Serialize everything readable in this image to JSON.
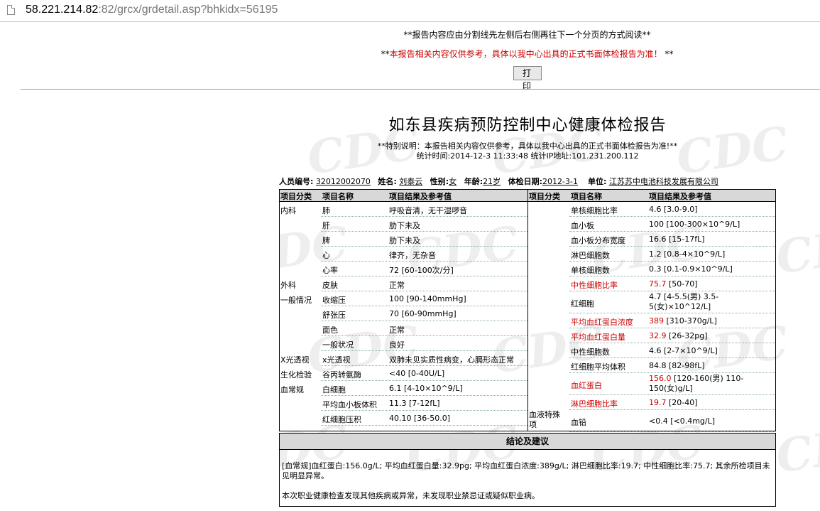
{
  "browser": {
    "url_host": "58.221.214.82",
    "url_rest": ":82/grcx/grdetail.asp?bhkidx=56195"
  },
  "notice": {
    "line1": "**报告内容应由分割线先左侧后右侧再往下一个分页的方式阅读**",
    "line2_prefix": "**",
    "line2_red": "本报告相关内容仅供参考，具体以我中心出具的正式书面体检报告为准！",
    "line2_suffix": " **"
  },
  "print_button": "打印",
  "watermark_text": "CDC",
  "report": {
    "title": "如东县疾病预防控制中心健康体检报告",
    "special_note": "**特别说明：本报告相关内容仅供参考，具体以我中心出具的正式书面体检报告为准!**",
    "stats_line": "统计时间:2014-12-3 11:33:48  统计IP地址:101.231.200.112"
  },
  "person": {
    "id_label": "人员编号:",
    "id_value": "32012002070",
    "name_label": "姓名:",
    "name_value": "刘泰云",
    "sex_label": "性别:",
    "sex_value": "女",
    "age_label": "年龄:",
    "age_value": "21岁",
    "date_label": "体检日期:",
    "date_value": "2012-3-1",
    "unit_label": "单位:",
    "unit_value": "江苏苏中电池科技发展有限公司"
  },
  "table_headers": {
    "category": "项目分类",
    "item": "项目名称",
    "result": "项目结果及参考值"
  },
  "left_rows": [
    {
      "cat": "内科",
      "item": "肺",
      "result": "呼吸音清，无干湿啰音",
      "red": false
    },
    {
      "cat": "",
      "item": "肝",
      "result": "肋下未及",
      "red": false
    },
    {
      "cat": "",
      "item": "脾",
      "result": "肋下未及",
      "red": false
    },
    {
      "cat": "",
      "item": "心",
      "result": "律齐，无杂音",
      "red": false
    },
    {
      "cat": "",
      "item": "心率",
      "result": "72  [60-100次/分]",
      "red": false
    },
    {
      "cat": "外科",
      "item": "皮肤",
      "result": "正常",
      "red": false
    },
    {
      "cat": "一般情况",
      "item": "收缩压",
      "result": "100  [90-140mmHg]",
      "red": false
    },
    {
      "cat": "",
      "item": "舒张压",
      "result": "70  [60-90mmHg]",
      "red": false
    },
    {
      "cat": "",
      "item": "面色",
      "result": "正常",
      "red": false
    },
    {
      "cat": "",
      "item": "一般状况",
      "result": "良好",
      "red": false
    },
    {
      "cat": "X光透视",
      "item": "x光透视",
      "result": "双肺未见实质性病变，心膈形态正常",
      "red": false
    },
    {
      "cat": "生化检验",
      "item": "谷丙转氨酶",
      "result": "<40  [0-40U/L]",
      "red": false
    },
    {
      "cat": "血常规",
      "item": "白细胞",
      "result": "6.1  [4-10×10^9/L]",
      "red": false
    },
    {
      "cat": "",
      "item": "平均血小板体积",
      "result": "11.3  [7-12fL]",
      "red": false
    },
    {
      "cat": "",
      "item": "红细胞压积",
      "result": "40.10  [36-50.0]",
      "red": false
    }
  ],
  "right_rows": [
    {
      "cat": "",
      "item": "单核细胞比率",
      "result": "4.6  [3.0-9.0]",
      "red": false
    },
    {
      "cat": "",
      "item": "血小板",
      "result": "100  [100-300×10^9/L]",
      "red": false
    },
    {
      "cat": "",
      "item": "血小板分布宽度",
      "result": "16.6  [15-17fL]",
      "red": false
    },
    {
      "cat": "",
      "item": "淋巴细胞数",
      "result": "1.2  [0.8-4×10^9/L]",
      "red": false
    },
    {
      "cat": "",
      "item": "单核细胞数",
      "result": "0.3  [0.1-0.9×10^9/L]",
      "red": false
    },
    {
      "cat": "",
      "item": "中性细胞比率",
      "result_red": "75.7",
      "result": "  [50-70]",
      "red": true
    },
    {
      "cat": "",
      "item": "红细胞",
      "result": "4.7  [4-5.5(男) 3.5-",
      "result2": "5(女)×10^12/L]",
      "red": false
    },
    {
      "cat": "",
      "item": "平均血红蛋白浓度",
      "result_red": "389",
      "result": "  [310-370g/L]",
      "red": true
    },
    {
      "cat": "",
      "item": "平均血红蛋白量",
      "result_red": "32.9",
      "result": "  [26-32pg]",
      "red": true
    },
    {
      "cat": "",
      "item": "中性细胞数",
      "result": "4.6  [2-7×10^9/L]",
      "red": false
    },
    {
      "cat": "",
      "item": "红细胞平均体积",
      "result": "84.8  [82-98fL]",
      "red": false
    },
    {
      "cat": "",
      "item": "血红蛋白",
      "result_red": "156.0",
      "result": "  [120-160(男) 110-",
      "result2": "150(女)g/L]",
      "red": true
    },
    {
      "cat": "",
      "item": "淋巴细胞比率",
      "result_red": "19.7",
      "result": "  [20-40]",
      "red": true
    },
    {
      "cat": "血液特殊",
      "cat2": "项",
      "item": "血铅",
      "result": "<0.4  [<0.4mg/L]",
      "red": false
    }
  ],
  "conclusion": {
    "header": "结论及建议",
    "text1": "[血常规]血红蛋白:156.0g/L; 平均血红蛋白量:32.9pg; 平均血红蛋白浓度:389g/L; 淋巴细胞比率:19.7; 中性细胞比率:75.7; 其余所检项目未见明显异常。",
    "text2": "本次职业健康检查发现其他疾病或异常，未发现职业禁忌证或疑似职业病。"
  }
}
